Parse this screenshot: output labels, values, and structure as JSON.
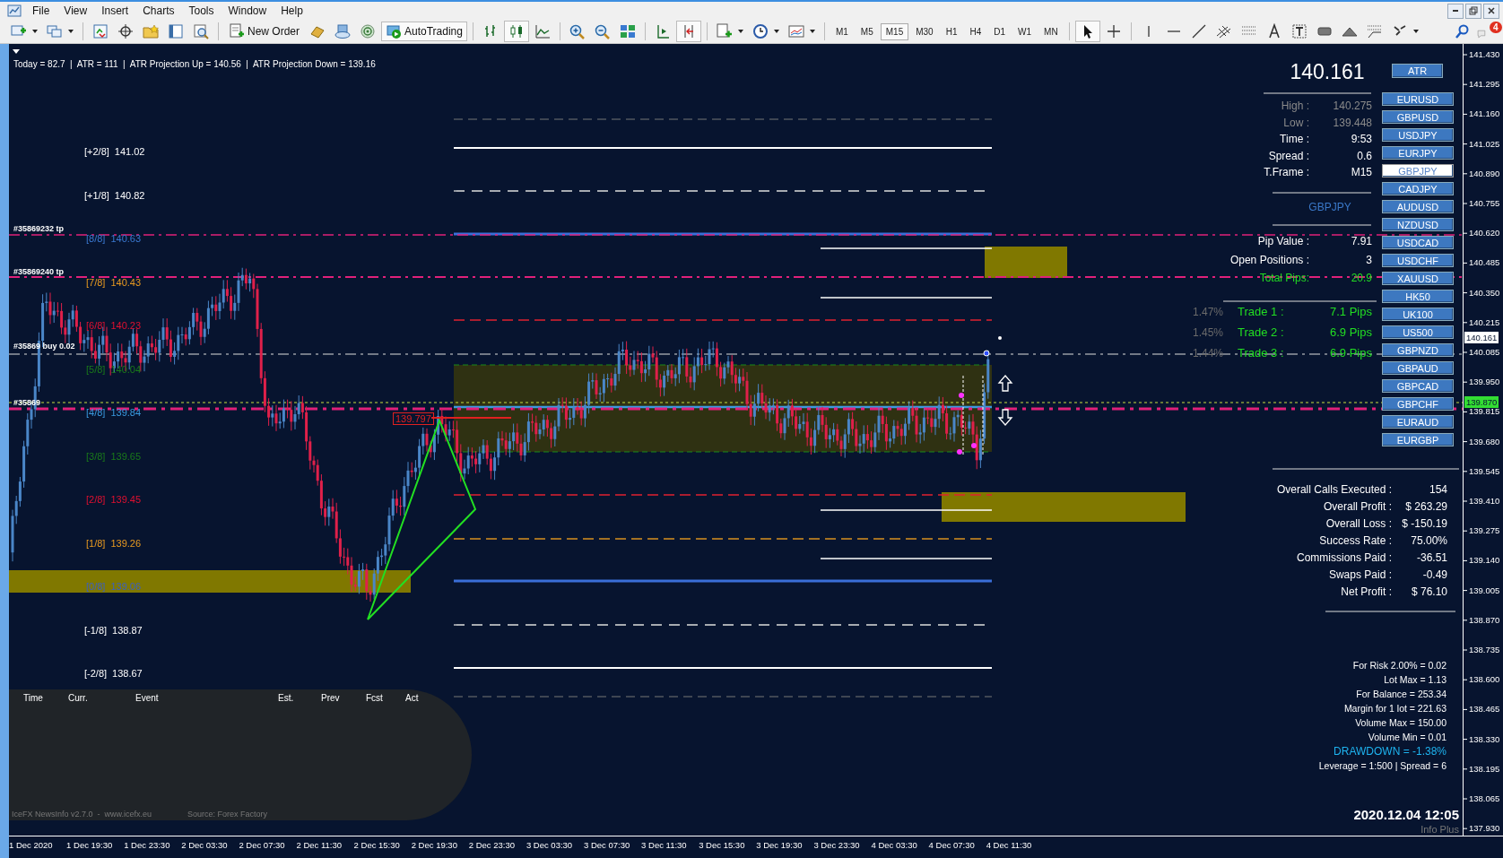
{
  "menu": [
    "File",
    "View",
    "Insert",
    "Charts",
    "Tools",
    "Window",
    "Help"
  ],
  "toolbar": {
    "new_order": "New Order",
    "autotrading": "AutoTrading",
    "timeframes": [
      {
        "label": "M1",
        "selected": false
      },
      {
        "label": "M5",
        "selected": false
      },
      {
        "label": "M15",
        "selected": true
      },
      {
        "label": "M30",
        "selected": false
      },
      {
        "label": "H1",
        "selected": false
      },
      {
        "label": "H4",
        "selected": false
      },
      {
        "label": "D1",
        "selected": false
      },
      {
        "label": "W1",
        "selected": false
      },
      {
        "label": "MN",
        "selected": false
      }
    ],
    "notification_count": "4"
  },
  "chart": {
    "info_line": "Today = 82.7  |  ATR = 111  |  ATR Projection Up = 140.56  |  ATR Projection Down = 139.16",
    "murrey_levels": [
      {
        "bracket": "[+2/8]",
        "value": "141.02",
        "color": "#ffffff"
      },
      {
        "bracket": "[+1/8]",
        "value": "140.82",
        "color": "#ffffff"
      },
      {
        "bracket": "[8/8]",
        "value": "140.63",
        "color": "#3a78d0"
      },
      {
        "bracket": "[7/8]",
        "value": "140.43",
        "color": "#e89a20"
      },
      {
        "bracket": "[6/8]",
        "value": "140.23",
        "color": "#e01030"
      },
      {
        "bracket": "[5/8]",
        "value": "140.04",
        "color": "#1a7a1a"
      },
      {
        "bracket": "[4/8]",
        "value": "139.84",
        "color": "#3a9ae0"
      },
      {
        "bracket": "[3/8]",
        "value": "139.65",
        "color": "#1a7a1a"
      },
      {
        "bracket": "[2/8]",
        "value": "139.45",
        "color": "#e01030"
      },
      {
        "bracket": "[1/8]",
        "value": "139.26",
        "color": "#e89a20"
      },
      {
        "bracket": "[0/8]",
        "value": "139.06",
        "color": "#3a60c0"
      },
      {
        "bracket": "[-1/8]",
        "value": "138.87",
        "color": "#ffffff"
      },
      {
        "bracket": "[-2/8]",
        "value": "138.67",
        "color": "#ffffff"
      }
    ],
    "order_labels": [
      "#35869232 tp",
      "#35869240 tp",
      "#35869 buy 0.02",
      "#35869"
    ],
    "price_tag": "139.797",
    "news": {
      "columns": [
        "Time",
        "Curr.",
        "Event",
        "Est.",
        "Prev",
        "Fcst",
        "Act"
      ],
      "footer": "IceFX NewsInfo v2.7.0  -  www.icefx.eu",
      "source": "Source: Forex Factory"
    }
  },
  "panel": {
    "price": "140.161",
    "atr_button": "ATR",
    "stats": [
      {
        "label": "High :",
        "value": "140.275",
        "kind": "dim"
      },
      {
        "label": "Low :",
        "value": "139.448",
        "kind": "dim"
      },
      {
        "label": "Time :",
        "value": "9:53",
        "kind": "normal"
      },
      {
        "label": "Spread :",
        "value": "0.6",
        "kind": "normal"
      },
      {
        "label": "T.Frame :",
        "value": "M15",
        "kind": "normal"
      }
    ],
    "symbol": "GBPJPY",
    "position_stats": [
      {
        "label": "Pip Value :",
        "value": "7.91",
        "kind": "normal"
      },
      {
        "label": "Open Positions :",
        "value": "3",
        "kind": "normal"
      },
      {
        "label": "Total Pips:",
        "value": "20.9",
        "kind": "total"
      }
    ],
    "trades": [
      {
        "percent": "1.47%",
        "label": "Trade 1 :",
        "value": "7.1 Pips"
      },
      {
        "percent": "1.45%",
        "label": "Trade 2 :",
        "value": "6.9 Pips"
      },
      {
        "percent": "1.44%",
        "label": "Trade 3 :",
        "value": "6.9 Pips"
      }
    ],
    "pairs": [
      {
        "label": "EURUSD",
        "selected": false
      },
      {
        "label": "GBPUSD",
        "selected": false
      },
      {
        "label": "USDJPY",
        "selected": false
      },
      {
        "label": "EURJPY",
        "selected": false
      },
      {
        "label": "GBPJPY",
        "selected": true
      },
      {
        "label": "CADJPY",
        "selected": false
      },
      {
        "label": "AUDUSD",
        "selected": false
      },
      {
        "label": "NZDUSD",
        "selected": false
      },
      {
        "label": "USDCAD",
        "selected": false
      },
      {
        "label": "USDCHF",
        "selected": false
      },
      {
        "label": "XAUUSD",
        "selected": false
      },
      {
        "label": "HK50",
        "selected": false
      },
      {
        "label": "UK100",
        "selected": false
      },
      {
        "label": "US500",
        "selected": false
      },
      {
        "label": "GBPNZD",
        "selected": false
      },
      {
        "label": "GBPAUD",
        "selected": false
      },
      {
        "label": "GBPCAD",
        "selected": false
      },
      {
        "label": "GBPCHF",
        "selected": false
      },
      {
        "label": "EURAUD",
        "selected": false
      },
      {
        "label": "EURGBP",
        "selected": false
      }
    ],
    "summary": [
      {
        "label": "Overall Calls Executed :",
        "value": "154"
      },
      {
        "label": "Overall Profit :",
        "value": "$ 263.29"
      },
      {
        "label": "Overall Loss :",
        "value": "$ -150.19"
      },
      {
        "label": "Success Rate :",
        "value": "75.00%"
      },
      {
        "label": "Commissions Paid :",
        "value": "-36.51"
      },
      {
        "label": "Swaps Paid :",
        "value": "-0.49"
      },
      {
        "label": "Net Profit :",
        "value": "$ 76.10"
      }
    ],
    "risk": [
      {
        "text": "For Risk 2.00% = 0.02",
        "kind": "normal"
      },
      {
        "text": "Lot Max = 1.13",
        "kind": "normal"
      },
      {
        "text": "For Balance = 253.34",
        "kind": "normal"
      },
      {
        "text": "Margin for 1 lot = 221.63",
        "kind": "normal"
      },
      {
        "text": "Volume Max = 150.00",
        "kind": "normal"
      },
      {
        "text": "Volume Min = 0.01",
        "kind": "normal"
      },
      {
        "text": "DRAWDOWN = -1.38%",
        "kind": "alert"
      },
      {
        "text": "Leverage = 1:500 | Spread = 6",
        "kind": "normal"
      }
    ],
    "timestamp": "2020.12.04 12:05",
    "brand": "Info Plus"
  },
  "price_axis": {
    "labels": [
      "141.430",
      "141.295",
      "141.160",
      "141.025",
      "140.890",
      "140.755",
      "140.620",
      "140.485",
      "140.350",
      "140.215",
      "140.085",
      "139.950",
      "139.815",
      "139.680",
      "139.545",
      "139.410",
      "139.275",
      "139.140",
      "139.005",
      "138.870",
      "138.735",
      "138.600",
      "138.465",
      "138.330",
      "138.195",
      "138.065",
      "137.930"
    ],
    "current_price": "140.161",
    "bid_price": "139.870"
  },
  "time_axis": [
    "1 Dec 2020",
    "1 Dec 19:30",
    "1 Dec 23:30",
    "2 Dec 03:30",
    "2 Dec 07:30",
    "2 Dec 11:30",
    "2 Dec 15:30",
    "2 Dec 19:30",
    "2 Dec 23:30",
    "3 Dec 03:30",
    "3 Dec 07:30",
    "3 Dec 11:30",
    "3 Dec 15:30",
    "3 Dec 19:30",
    "3 Dec 23:30",
    "4 Dec 03:30",
    "4 Dec 07:30",
    "4 Dec 11:30"
  ]
}
